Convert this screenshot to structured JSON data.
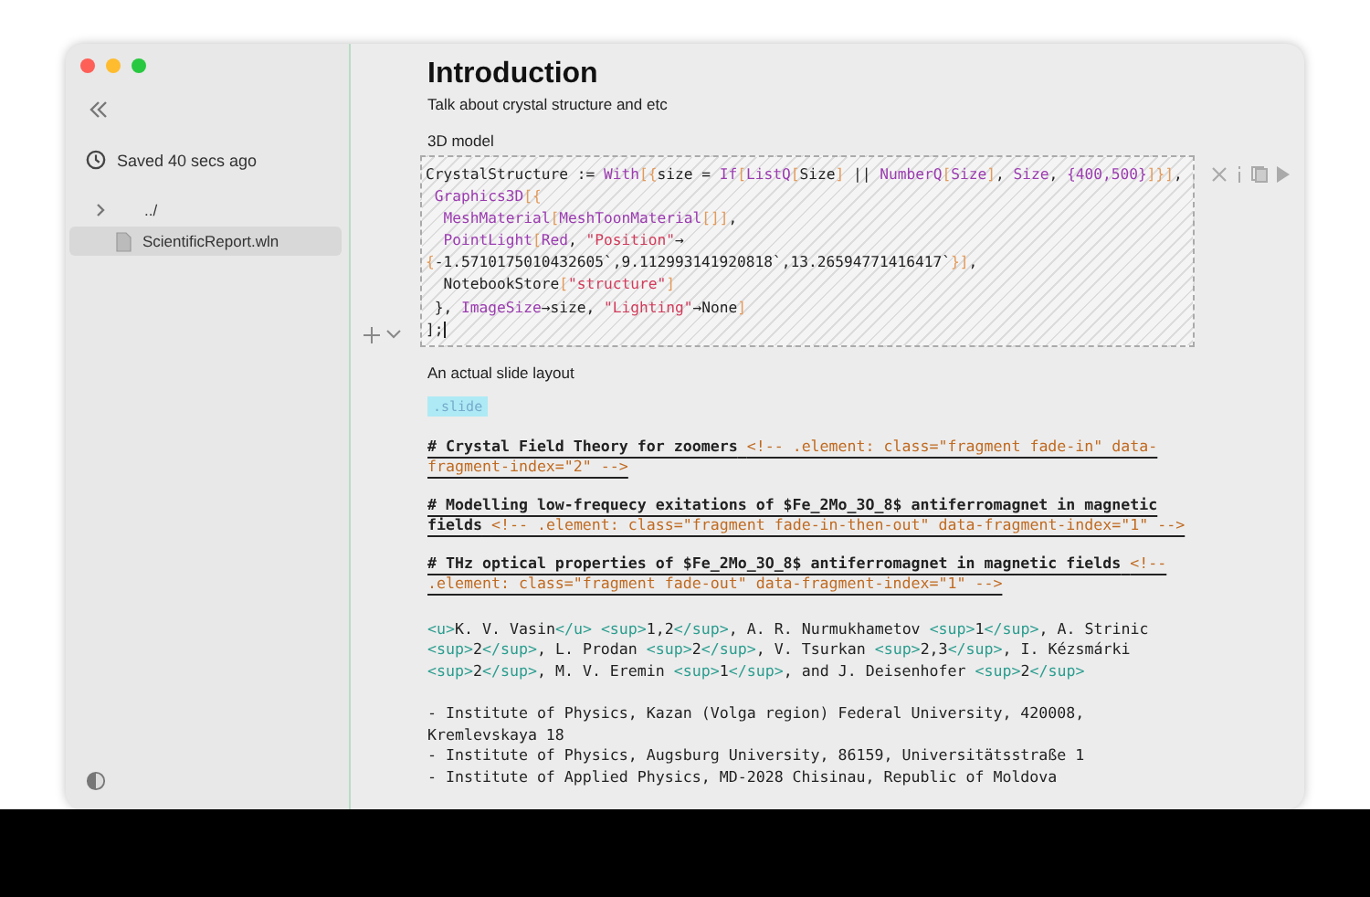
{
  "sidebar": {
    "status": "Saved 40 secs ago",
    "tree": [
      {
        "label": "../",
        "expanded": false,
        "selected": false
      },
      {
        "label": "ScientificReport.wln",
        "selected": true
      }
    ]
  },
  "title": "Introduction",
  "subtitle": "Talk about crystal structure and etc",
  "code_cell": {
    "label": "3D model",
    "lines": [
      [
        {
          "kind": "plain",
          "text": "CrystalStructure := "
        },
        {
          "kind": "fn",
          "text": "With"
        },
        {
          "kind": "br",
          "text": "[{"
        },
        {
          "kind": "plain",
          "text": "size = "
        },
        {
          "kind": "fn",
          "text": "If"
        },
        {
          "kind": "br",
          "text": "["
        },
        {
          "kind": "fn",
          "text": "ListQ"
        },
        {
          "kind": "br",
          "text": "["
        },
        {
          "kind": "plain",
          "text": "Size"
        },
        {
          "kind": "br",
          "text": "]"
        },
        {
          "kind": "plain",
          "text": " || "
        },
        {
          "kind": "fn",
          "text": "NumberQ"
        },
        {
          "kind": "br",
          "text": "["
        },
        {
          "kind": "fn",
          "text": "Size"
        },
        {
          "kind": "br",
          "text": "]"
        },
        {
          "kind": "plain",
          "text": ", "
        },
        {
          "kind": "fn",
          "text": "Size"
        },
        {
          "kind": "plain",
          "text": ", "
        },
        {
          "kind": "num",
          "text": "{400,500}"
        },
        {
          "kind": "br",
          "text": "]}]"
        },
        {
          "kind": "plain",
          "text": ","
        }
      ],
      [
        {
          "kind": "fn",
          "text": " Graphics3D"
        },
        {
          "kind": "br",
          "text": "[{"
        }
      ],
      [
        {
          "kind": "fn",
          "text": "  MeshMaterial"
        },
        {
          "kind": "br",
          "text": "["
        },
        {
          "kind": "fn",
          "text": "MeshToonMaterial"
        },
        {
          "kind": "br",
          "text": "[]]"
        },
        {
          "kind": "plain",
          "text": ","
        }
      ],
      [
        {
          "kind": "fn",
          "text": "  PointLight"
        },
        {
          "kind": "br",
          "text": "["
        },
        {
          "kind": "fn",
          "text": "Red"
        },
        {
          "kind": "plain",
          "text": ", "
        },
        {
          "kind": "str",
          "text": "\"Position\""
        },
        {
          "kind": "plain",
          "text": "→"
        }
      ],
      [
        {
          "kind": "br",
          "text": "{"
        },
        {
          "kind": "plain",
          "text": "-1.5710175010432605`,9.112993141920818`,13.26594771416417`"
        },
        {
          "kind": "br",
          "text": "}]"
        },
        {
          "kind": "plain",
          "text": ","
        }
      ],
      [
        {
          "kind": "plain",
          "text": "  NotebookStore"
        },
        {
          "kind": "br",
          "text": "["
        },
        {
          "kind": "str",
          "text": "\"structure\""
        },
        {
          "kind": "br",
          "text": "]"
        }
      ],
      [
        {
          "kind": "plain",
          "text": " }, "
        },
        {
          "kind": "fn",
          "text": "ImageSize"
        },
        {
          "kind": "plain",
          "text": "→size, "
        },
        {
          "kind": "str",
          "text": "\"Lighting\""
        },
        {
          "kind": "plain",
          "text": "→None"
        },
        {
          "kind": "br",
          "text": "]"
        }
      ],
      [
        {
          "kind": "plain",
          "text": "];"
        }
      ]
    ]
  },
  "slide_cell": {
    "label": "An actual slide layout",
    "tag": ".slide",
    "headings": [
      {
        "text": "# Crystal Field Theory for zoomers",
        "comment": "<!-- .element: class=\"fragment fade-in\" data-fragment-index=\"2\" -->"
      },
      {
        "text": "# Modelling low-frequecy exitations of $Fe_2Mo_3O_8$ antiferromagnet in magnetic fields",
        "comment": "<!-- .element: class=\"fragment fade-in-then-out\" data-fragment-index=\"1\" -->"
      },
      {
        "text": "# THz optical properties of $Fe_2Mo_3O_8$ antiferromagnet in magnetic fields",
        "comment": "<!-- .element: class=\"fragment fade-out\" data-fragment-index=\"1\" -->"
      }
    ],
    "authors": [
      {
        "kind": "tag",
        "text": "<u>"
      },
      {
        "kind": "plain",
        "text": "K. V. Vasin"
      },
      {
        "kind": "tag",
        "text": "</u> "
      },
      {
        "kind": "tag",
        "text": "<sup>"
      },
      {
        "kind": "plain",
        "text": "1,2"
      },
      {
        "kind": "tag",
        "text": "</sup>"
      },
      {
        "kind": "plain",
        "text": ", A. R. Nurmukhametov "
      },
      {
        "kind": "tag",
        "text": "<sup>"
      },
      {
        "kind": "plain",
        "text": "1"
      },
      {
        "kind": "tag",
        "text": "</sup>"
      },
      {
        "kind": "plain",
        "text": ",  A. Strinic "
      },
      {
        "kind": "tag",
        "text": "<sup>"
      },
      {
        "kind": "plain",
        "text": "2"
      },
      {
        "kind": "tag",
        "text": "</sup>"
      },
      {
        "kind": "plain",
        "text": ", L. Prodan "
      },
      {
        "kind": "tag",
        "text": "<sup>"
      },
      {
        "kind": "plain",
        "text": "2"
      },
      {
        "kind": "tag",
        "text": "</sup>"
      },
      {
        "kind": "plain",
        "text": ", V. Tsurkan "
      },
      {
        "kind": "tag",
        "text": "<sup>"
      },
      {
        "kind": "plain",
        "text": "2,3"
      },
      {
        "kind": "tag",
        "text": "</sup>"
      },
      {
        "kind": "plain",
        "text": ", I. Kézsmárki "
      },
      {
        "kind": "tag",
        "text": "<sup>"
      },
      {
        "kind": "plain",
        "text": "2"
      },
      {
        "kind": "tag",
        "text": "</sup>"
      },
      {
        "kind": "plain",
        "text": ", M. V. Eremin "
      },
      {
        "kind": "tag",
        "text": "<sup>"
      },
      {
        "kind": "plain",
        "text": "1"
      },
      {
        "kind": "tag",
        "text": "</sup>"
      },
      {
        "kind": "plain",
        "text": ", and J. Deisenhofer "
      },
      {
        "kind": "tag",
        "text": "<sup>"
      },
      {
        "kind": "plain",
        "text": "2"
      },
      {
        "kind": "tag",
        "text": "</sup>"
      }
    ],
    "affiliations": [
      "- Institute of Physics, Kazan (Volga region) Federal University, 420008, Kremlevskaya 18",
      "- Institute of Physics, Augsburg University, 86159, Universitätsstraße 1",
      "- Institute of Applied Physics, MD-2028 Chisinau, Republic of Moldova"
    ]
  }
}
